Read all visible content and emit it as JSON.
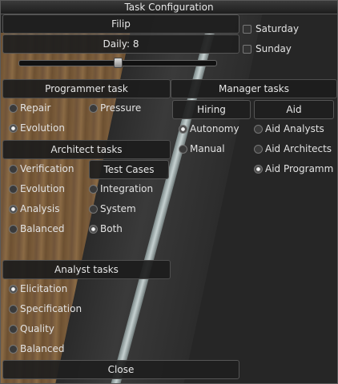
{
  "window": {
    "title": "Task Configuration"
  },
  "person": {
    "name": "Filip"
  },
  "daily": {
    "label": "Daily: 8",
    "slider_fraction": 0.5
  },
  "days": [
    {
      "label": "Saturday"
    },
    {
      "label": "Sunday"
    }
  ],
  "programmer": {
    "header": "Programmer task",
    "options": [
      {
        "label": "Repair",
        "selected": false
      },
      {
        "label": "Pressure",
        "selected": false
      },
      {
        "label": "Evolution",
        "selected": true
      }
    ]
  },
  "architect": {
    "header": "Architect tasks",
    "test_cases_button": "Test Cases",
    "options": [
      {
        "label": "Verification",
        "selected": false
      },
      {
        "label": "Evolution",
        "selected": false
      },
      {
        "label": "Integration",
        "selected": false
      },
      {
        "label": "Analysis",
        "selected": true
      },
      {
        "label": "System",
        "selected": false
      },
      {
        "label": "Balanced",
        "selected": false
      },
      {
        "label": "Both",
        "selected": true
      }
    ]
  },
  "analyst": {
    "header": "Analyst tasks",
    "options": [
      {
        "label": "Elicitation",
        "selected": true
      },
      {
        "label": "Specification",
        "selected": false
      },
      {
        "label": "Quality",
        "selected": false
      },
      {
        "label": "Balanced",
        "selected": false
      }
    ]
  },
  "manager": {
    "header": "Manager tasks",
    "hiring_tab": "Hiring",
    "aid_tab": "Aid",
    "hiring_options": [
      {
        "label": "Autonomy",
        "selected": true
      },
      {
        "label": "Manual",
        "selected": false
      }
    ],
    "aid_options": [
      {
        "label": "Aid Analysts",
        "selected": false
      },
      {
        "label": "Aid Architects",
        "selected": false
      },
      {
        "label": "Aid Programm",
        "selected": true
      }
    ]
  },
  "close_button": "Close"
}
